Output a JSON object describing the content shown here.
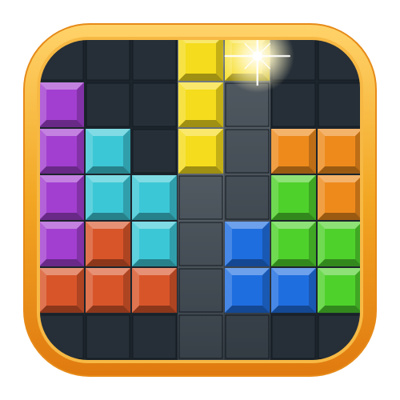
{
  "app_icon": {
    "name": "block-puzzle-app-icon",
    "frame_colors": {
      "outer_rim": "#f2a623",
      "rim_highlight": "#ffd36a",
      "rim_shadow": "#e07a10",
      "board_background": "#1c242c",
      "grid_cell": "#262f38",
      "drop_column_light": "#9aa2aa",
      "drop_column_dark": "#4a525a"
    },
    "board": {
      "columns": 7,
      "rows": 7,
      "drop_column_index": 3,
      "drop_column_index_2": 4
    },
    "colors": {
      "Y": "#f5dc1c",
      "P": "#a23fd0",
      "C": "#3cc7d6",
      "O": "#ee8a1c",
      "G": "#4fd12c",
      "B": "#1f6ee0",
      "R": "#d8552a"
    },
    "blocks": [
      {
        "col": 3,
        "row": 0,
        "color": "Y"
      },
      {
        "col": 4,
        "row": 0,
        "color": "Y"
      },
      {
        "col": 3,
        "row": 1,
        "color": "Y"
      },
      {
        "col": 3,
        "row": 2,
        "color": "Y"
      },
      {
        "col": 0,
        "row": 1,
        "color": "P"
      },
      {
        "col": 0,
        "row": 2,
        "color": "P"
      },
      {
        "col": 0,
        "row": 3,
        "color": "P"
      },
      {
        "col": 0,
        "row": 4,
        "color": "P"
      },
      {
        "col": 1,
        "row": 2,
        "color": "C"
      },
      {
        "col": 1,
        "row": 3,
        "color": "C"
      },
      {
        "col": 2,
        "row": 3,
        "color": "C"
      },
      {
        "col": 2,
        "row": 4,
        "color": "C"
      },
      {
        "col": 5,
        "row": 2,
        "color": "O"
      },
      {
        "col": 6,
        "row": 2,
        "color": "O"
      },
      {
        "col": 6,
        "row": 3,
        "color": "O"
      },
      {
        "col": 5,
        "row": 3,
        "color": "G"
      },
      {
        "col": 5,
        "row": 4,
        "color": "G"
      },
      {
        "col": 6,
        "row": 4,
        "color": "G"
      },
      {
        "col": 6,
        "row": 5,
        "color": "G"
      },
      {
        "col": 4,
        "row": 4,
        "color": "B"
      },
      {
        "col": 4,
        "row": 5,
        "color": "B"
      },
      {
        "col": 5,
        "row": 5,
        "color": "B"
      },
      {
        "col": 1,
        "row": 4,
        "color": "R"
      },
      {
        "col": 0,
        "row": 5,
        "color": "R"
      },
      {
        "col": 1,
        "row": 5,
        "color": "R"
      },
      {
        "col": 2,
        "row": 5,
        "color": "R"
      }
    ],
    "sparkle": {
      "col": 4,
      "row": 0,
      "color": "#fff7c8"
    }
  }
}
